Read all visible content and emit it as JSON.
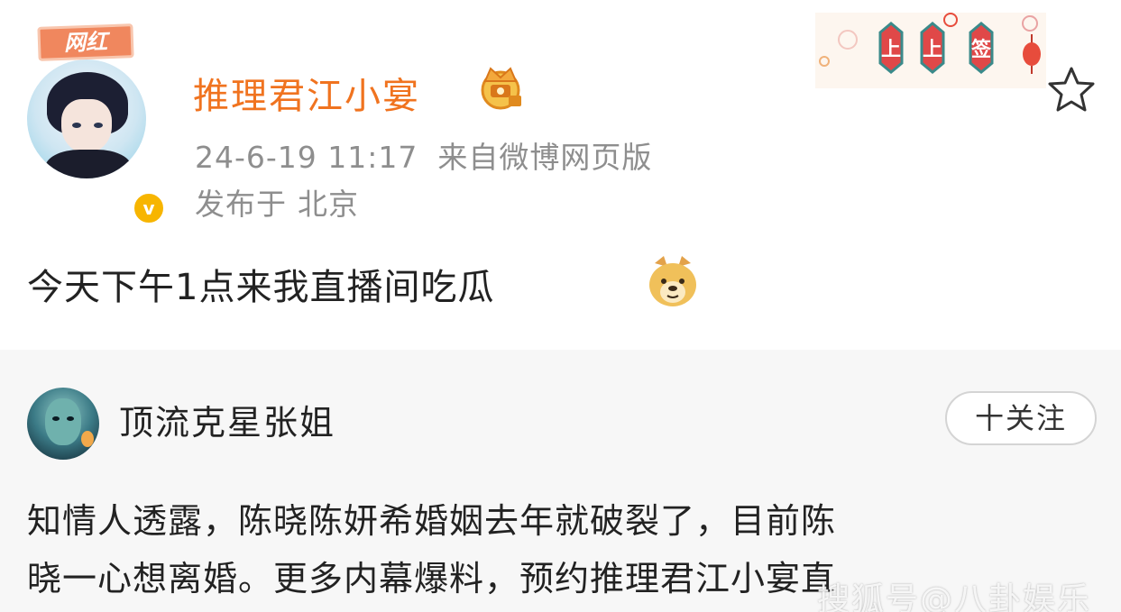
{
  "post": {
    "avatar_badge": "网红",
    "verified_mark": "v",
    "username": "推理君江小宴",
    "time": "24-6-19 11:17",
    "source": "来自微博网页版",
    "location_prefix": "发布于",
    "location": "北京",
    "content": "今天下午1点来我直播间吃瓜",
    "emoji": "doge-icon",
    "banner": {
      "text": [
        "上",
        "上",
        "签"
      ]
    }
  },
  "repost": {
    "username": "顶流克星张姐",
    "follow_label": "十关注",
    "lines": [
      "知情人透露，陈晓陈妍希婚姻去年就破裂了，目前陈",
      "晓一心想离婚。更多内幕爆料，预约推理君江小宴直"
    ]
  },
  "watermark": "搜狐号@八卦娱乐",
  "colors": {
    "username": "#f0731f",
    "meta": "#8e8e8e",
    "repost_bg": "#f7f7f7",
    "badge": "#f0875e",
    "verified": "#f7b500"
  }
}
